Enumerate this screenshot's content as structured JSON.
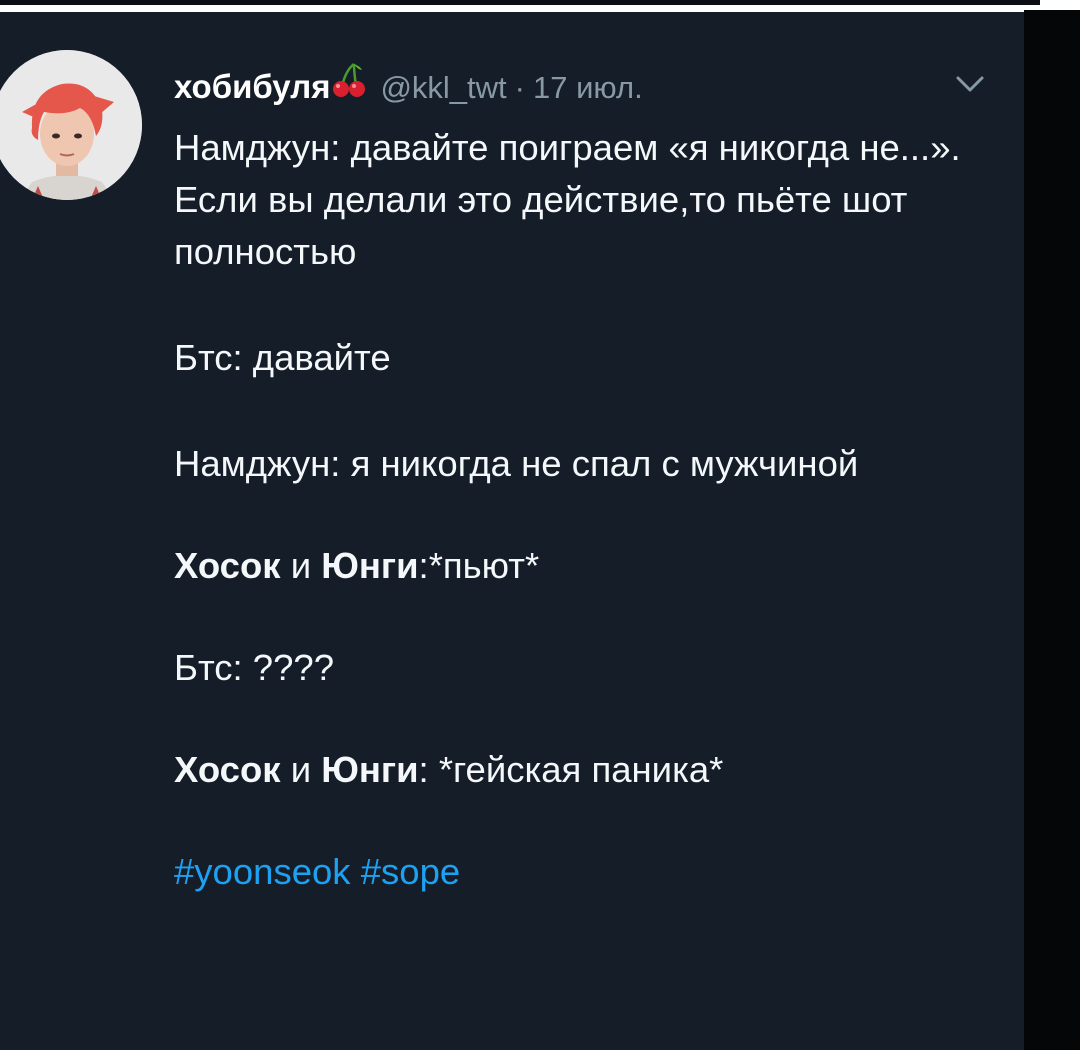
{
  "tweet": {
    "author": {
      "display_name": "хобибуля",
      "handle": "@kkl_twt",
      "separator": "·",
      "time": "17 июл.",
      "avatar_icon": "profile-photo",
      "name_emoji_icon": "cherries-icon"
    },
    "menu_icon": "chevron-down-icon",
    "paragraphs": {
      "p1": "Намджун: давайте поиграем «я никогда не...». Если вы делали это действие,то пьёте шот полностью",
      "p2": "Бтс: давайте",
      "p3": "Намджун: я никогда не спал с мужчиной",
      "p4": {
        "name1": "Хосок",
        "conj": " и ",
        "name2": "Юнги",
        "rest": ":*пьют*"
      },
      "p5": "Бтс: ????",
      "p6": {
        "name1": "Хосок",
        "conj": " и ",
        "name2": "Юнги",
        "rest": ": *гейская паника*"
      }
    },
    "hashtags": [
      "#yoonseok",
      "#sope"
    ]
  },
  "colors": {
    "background": "#151d28",
    "text": "#f5f8fa",
    "muted": "#8899a6",
    "link": "#1da1f2"
  }
}
